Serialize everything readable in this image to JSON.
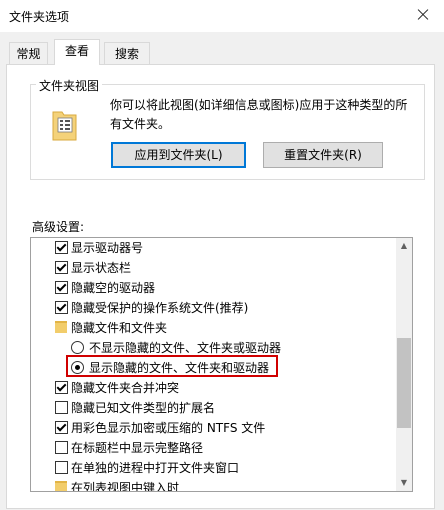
{
  "window": {
    "title": "文件夹选项"
  },
  "tabs": [
    {
      "label": "常规"
    },
    {
      "label": "查看"
    },
    {
      "label": "搜索"
    }
  ],
  "folder_views": {
    "title": "文件夹视图",
    "description_line1": "你可以将此视图(如详细信息或图标)应用于这种类型的所",
    "description_line2": "有文件夹。",
    "apply_label": "应用到文件夹(L)",
    "reset_label": "重置文件夹(R)"
  },
  "advanced": {
    "label": "高级设置:",
    "items": [
      {
        "type": "checkbox",
        "checked": true,
        "label": "显示驱动器号"
      },
      {
        "type": "checkbox",
        "checked": true,
        "label": "显示状态栏"
      },
      {
        "type": "checkbox",
        "checked": true,
        "label": "隐藏空的驱动器"
      },
      {
        "type": "checkbox",
        "checked": true,
        "label": "隐藏受保护的操作系统文件(推荐)"
      },
      {
        "type": "folder",
        "label": "隐藏文件和文件夹"
      },
      {
        "type": "radio",
        "selected": false,
        "label": "不显示隐藏的文件、文件夹或驱动器"
      },
      {
        "type": "radio",
        "selected": true,
        "label": "显示隐藏的文件、文件夹和驱动器"
      },
      {
        "type": "checkbox",
        "checked": true,
        "label": "隐藏文件夹合并冲突"
      },
      {
        "type": "checkbox",
        "checked": false,
        "label": "隐藏已知文件类型的扩展名"
      },
      {
        "type": "checkbox",
        "checked": true,
        "label": "用彩色显示加密或压缩的 NTFS 文件"
      },
      {
        "type": "checkbox",
        "checked": false,
        "label": "在标题栏中显示完整路径"
      },
      {
        "type": "checkbox",
        "checked": false,
        "label": "在单独的进程中打开文件夹窗口"
      },
      {
        "type": "folder",
        "label": "在列表视图中键入时"
      }
    ]
  },
  "colors": {
    "highlight": "#d00000",
    "accent": "#0078d7"
  }
}
